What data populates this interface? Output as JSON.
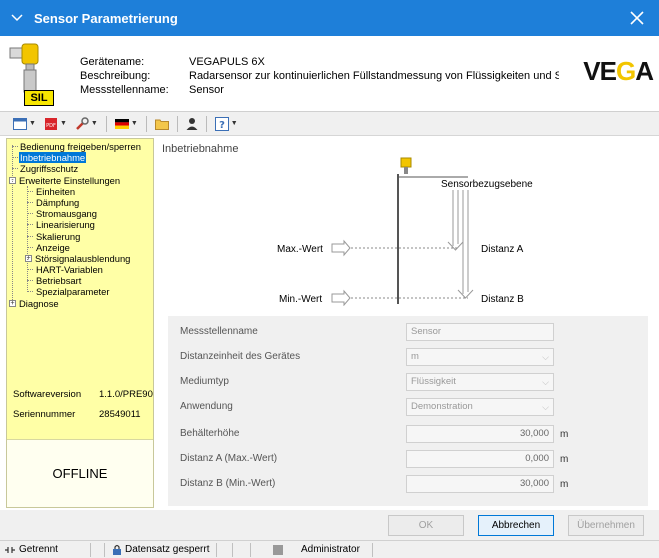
{
  "window": {
    "title": "Sensor Parametrierung"
  },
  "header": {
    "labels": [
      "Gerätename:",
      "Beschreibung:",
      "Messstellenname:"
    ],
    "values": [
      "VEGAPULS 6X",
      "Radarsensor zur kontinuierlichen Füllstandmessung von Flüssigkeiten und Schüttgütern ...",
      "Sensor"
    ],
    "sil_badge": "SIL",
    "logo": "VEGA"
  },
  "toolbar": {
    "icons": [
      "view-icon",
      "pdf-icon",
      "tools-icon",
      "language-flag-icon",
      "folder-icon",
      "user-icon",
      "help-icon"
    ]
  },
  "tree": {
    "items": [
      {
        "label": "Bedienung freigeben/sperren",
        "level": 0,
        "selected": false
      },
      {
        "label": "Inbetriebnahme",
        "level": 0,
        "selected": true
      },
      {
        "label": "Zugriffsschutz",
        "level": 0,
        "selected": false
      },
      {
        "label": "Erweiterte Einstellungen",
        "level": 0,
        "expander": "-"
      },
      {
        "label": "Einheiten",
        "level": 1
      },
      {
        "label": "Dämpfung",
        "level": 1
      },
      {
        "label": "Stromausgang",
        "level": 1
      },
      {
        "label": "Linearisierung",
        "level": 1
      },
      {
        "label": "Skalierung",
        "level": 1
      },
      {
        "label": "Anzeige",
        "level": 1
      },
      {
        "label": "Störsignalausblendung",
        "level": 1,
        "expander": "+"
      },
      {
        "label": "HART-Variablen",
        "level": 1
      },
      {
        "label": "Betriebsart",
        "level": 1
      },
      {
        "label": "Spezialparameter",
        "level": 1
      },
      {
        "label": "Diagnose",
        "level": 0,
        "expander": "+"
      }
    ]
  },
  "info": {
    "software_label": "Softwareversion",
    "software_value": "1.1.0/PRE90",
    "serial_label": "Seriennummer",
    "serial_value": "28549011",
    "status": "OFFLINE"
  },
  "main": {
    "title": "Inbetriebnahme",
    "diagram": {
      "reference": "Sensorbezugsebene",
      "max_label": "Max.-Wert",
      "min_label": "Min.-Wert",
      "dist_a": "Distanz A",
      "dist_b": "Distanz B"
    },
    "form": [
      {
        "label": "Messstellenname",
        "value": "Sensor",
        "kind": "text"
      },
      {
        "label": "Distanzeinheit des Gerätes",
        "value": "m",
        "kind": "select"
      },
      {
        "label": "Mediumtyp",
        "value": "Flüssigkeit",
        "kind": "select"
      },
      {
        "label": "Anwendung",
        "value": "Demonstration",
        "kind": "select"
      },
      {
        "label": "Behälterhöhe",
        "value": "30,000",
        "kind": "number",
        "unit": "m"
      },
      {
        "label": "Distanz A (Max.-Wert)",
        "value": "0,000",
        "kind": "number",
        "unit": "m"
      },
      {
        "label": "Distanz B (Min.-Wert)",
        "value": "30,000",
        "kind": "number",
        "unit": "m"
      }
    ]
  },
  "buttons": {
    "ok": "OK",
    "cancel": "Abbrechen",
    "apply": "Übernehmen"
  },
  "statusbar": {
    "connection": "Getrennt",
    "dataset": "Datensatz gesperrt",
    "user": "Administrator"
  },
  "colors": {
    "titlebar": "#1e7fd9",
    "tree_bg": "#ffffa6",
    "selection": "#0078d7",
    "sensor_yellow": "#f2c500"
  }
}
